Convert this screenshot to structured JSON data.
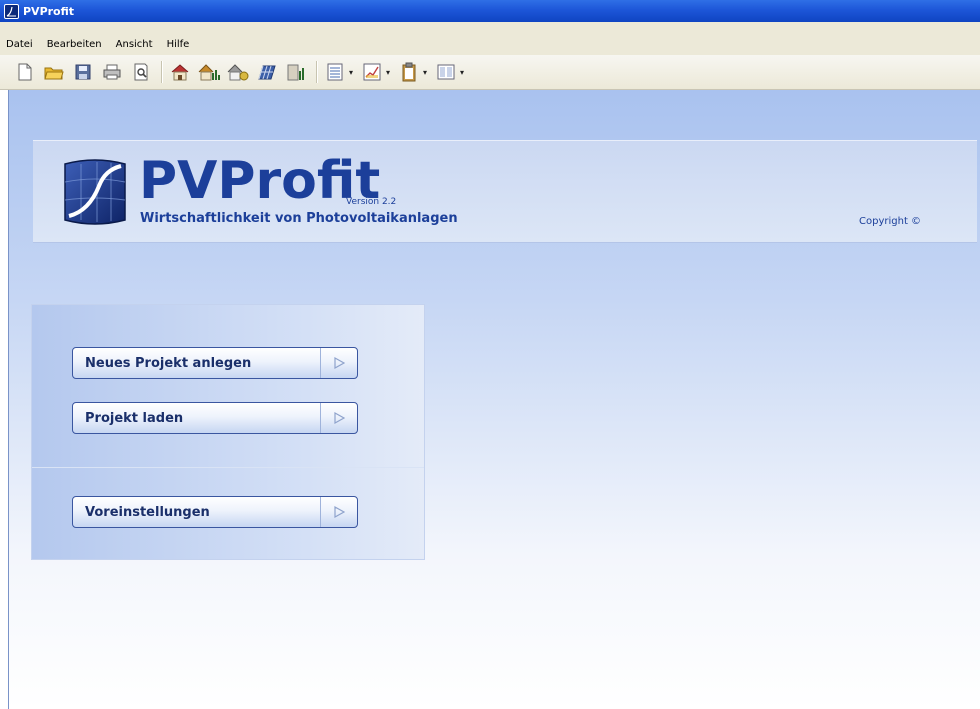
{
  "window": {
    "title": "PVProfit"
  },
  "menu": [
    "Datei",
    "Bearbeiten",
    "Ansicht",
    "Hilfe"
  ],
  "toolbar": {
    "icons": [
      "new-document-icon",
      "open-folder-icon",
      "save-icon",
      "print-icon",
      "print-preview-icon",
      "house-icon",
      "house-chart-icon",
      "house-money-icon",
      "solar-panel-icon",
      "building-chart-icon",
      "list-view-icon",
      "line-chart-icon",
      "clipboard-icon",
      "columns-icon"
    ]
  },
  "banner": {
    "title": "PVProfit",
    "version": "Version 2.2",
    "subtitle": "Wirtschaftlichkeit von Photovoltaikanlagen",
    "copyright": "Copyright ©"
  },
  "actions": {
    "new_project": "Neues Projekt anlegen",
    "load_project": "Projekt laden",
    "settings": "Voreinstellungen"
  },
  "colors": {
    "brand": "#1c3f9a",
    "titlebar": "#1d56d8",
    "button_border": "#3a56a0"
  }
}
